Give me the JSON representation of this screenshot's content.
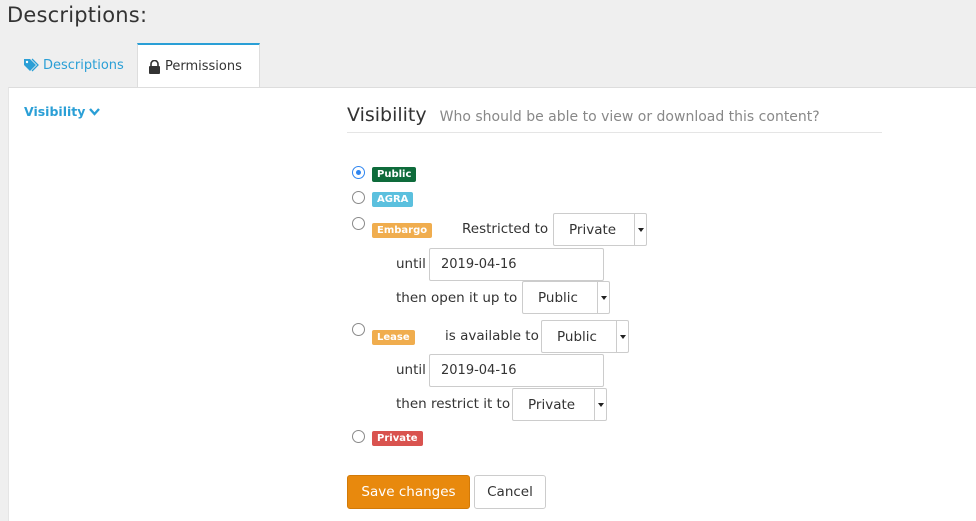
{
  "page": {
    "title": "Descriptions:"
  },
  "tabs": [
    {
      "label": "Descriptions",
      "icon": "tag-icon",
      "active": false
    },
    {
      "label": "Permissions",
      "icon": "lock-icon",
      "active": true
    }
  ],
  "sidebar": {
    "toggle_label": "Visibility",
    "icon": "chevron-down-icon"
  },
  "visibility": {
    "title": "Visibility",
    "subtitle": "Who should be able to view or download this content?",
    "options": [
      {
        "badge": "Public",
        "color": "#0e6b3b",
        "selected": true
      },
      {
        "badge": "AGRA",
        "color": "#5bc0de",
        "selected": false
      },
      {
        "badge": "Embargo",
        "color": "#f0ad4e",
        "selected": false
      },
      {
        "badge": "Lease",
        "color": "#f0ad4e",
        "selected": false
      },
      {
        "badge": "Private",
        "color": "#d9534f",
        "selected": false
      }
    ],
    "embargo": {
      "restricted_label": "Restricted to",
      "restricted_value": "Private",
      "until_label": "until",
      "until_value": "2019-04-16",
      "then_label": "then open it up to",
      "then_value": "Public"
    },
    "lease": {
      "available_label": "is available to",
      "available_value": "Public",
      "until_label": "until",
      "until_value": "2019-04-16",
      "then_label": "then restrict it to",
      "then_value": "Private"
    }
  },
  "actions": {
    "save_label": "Save changes",
    "cancel_label": "Cancel"
  }
}
